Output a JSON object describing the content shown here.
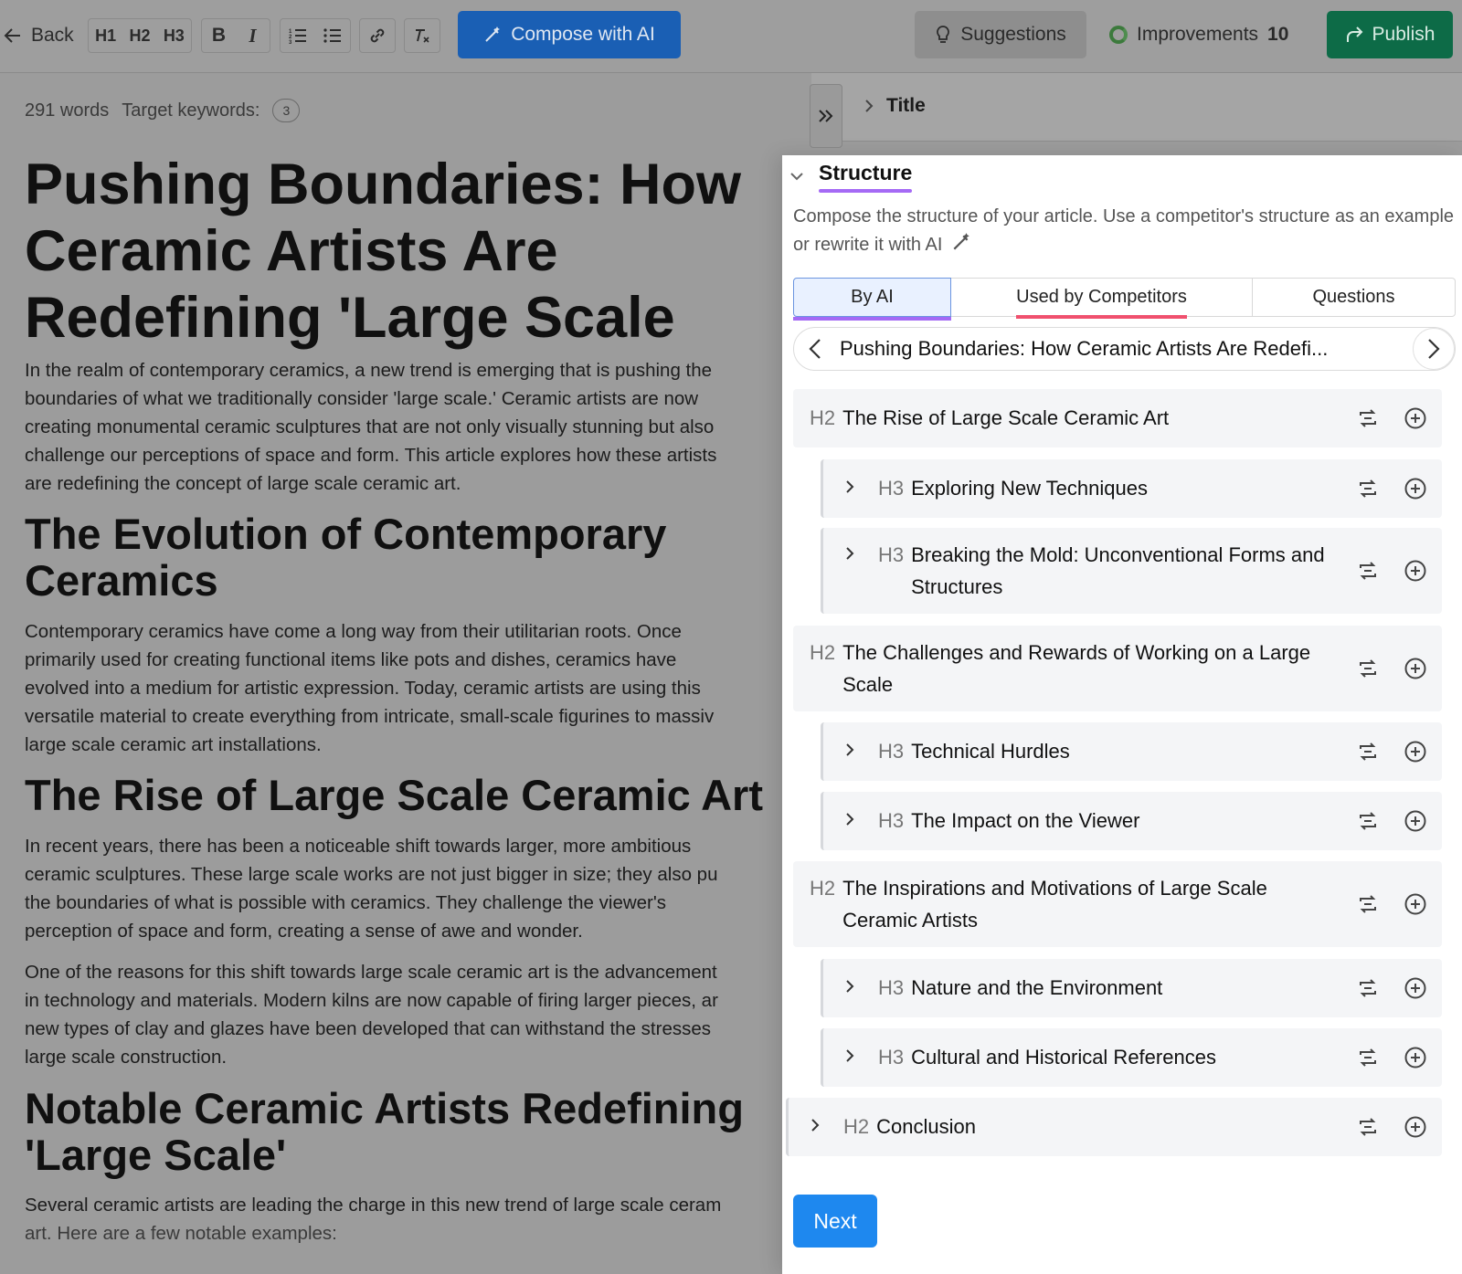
{
  "toolbar": {
    "back_label": "Back",
    "heading_buttons": [
      "H1",
      "H2",
      "H3"
    ],
    "bold_label": "B",
    "italic_label": "I",
    "compose_label": "Compose with AI",
    "suggestions_label": "Suggestions",
    "improvements_label": "Improvements",
    "improvements_count": "10",
    "publish_label": "Publish"
  },
  "editor": {
    "word_count": "291 words",
    "keywords_label": "Target keywords:",
    "keywords_count": "3",
    "title": "Pushing Boundaries: How Ceramic Artists Are Redefining 'Large Scale",
    "intro_lines": [
      "In the realm of contemporary ceramics, a new trend is emerging that is pushing the",
      "boundaries of what we traditionally consider 'large scale.' Ceramic artists are now",
      "creating monumental ceramic sculptures that are not only visually stunning but also",
      "challenge our perceptions of space and form. This article explores how these artists",
      "are redefining the concept of large scale ceramic art."
    ],
    "section1_heading": "The Evolution of Contemporary Ceramics",
    "section1_lines": [
      "Contemporary ceramics have come a long way from their utilitarian roots. Once",
      "primarily used for creating functional items like pots and dishes, ceramics have",
      "evolved into a medium for artistic expression. Today, ceramic artists are using this",
      "versatile material to create everything from intricate, small-scale figurines to massiv",
      "large scale ceramic art installations."
    ],
    "section2_heading": "The Rise of Large Scale Ceramic Art",
    "section2_lines": [
      "In recent years, there has been a noticeable shift towards larger, more ambitious",
      "ceramic sculptures. These large scale works are not just bigger in size; they also pu",
      "the boundaries of what is possible with ceramics. They challenge the viewer's",
      "perception of space and form, creating a sense of awe and wonder."
    ],
    "section2b_lines": [
      "One of the reasons for this shift towards large scale ceramic art is the advancement",
      "in technology and materials. Modern kilns are now capable of firing larger pieces, ar",
      "new types of clay and glazes have been developed that can withstand the stresses",
      "large scale construction."
    ],
    "section3_heading": "Notable Ceramic Artists Redefining 'Large Scale'",
    "section3_lines": [
      "Several ceramic artists are leading the charge in this new trend of large scale ceram",
      "art. Here are a few notable examples:"
    ]
  },
  "panel": {
    "title_section": "Title",
    "structure_title": "Structure",
    "structure_desc": "Compose the structure of your article. Use a competitor's structure as an example or rewrite it with AI",
    "tabs": [
      "By AI",
      "Used by Competitors",
      "Questions"
    ],
    "selected_title": "Pushing Boundaries: How Ceramic Artists Are Redefi...",
    "outline": [
      {
        "level": "H2",
        "text": "The Rise of Large Scale Ceramic Art"
      },
      {
        "level": "H3",
        "text": "Exploring New Techniques"
      },
      {
        "level": "H3",
        "text": "Breaking the Mold: Unconventional Forms and Structures"
      },
      {
        "level": "H2",
        "text": "The Challenges and Rewards of Working on a Large Scale"
      },
      {
        "level": "H3",
        "text": "Technical Hurdles"
      },
      {
        "level": "H3",
        "text": "The Impact on the Viewer"
      },
      {
        "level": "H2",
        "text": "The Inspirations and Motivations of Large Scale Ceramic Artists"
      },
      {
        "level": "H3",
        "text": "Nature and the Environment"
      },
      {
        "level": "H3",
        "text": "Cultural and Historical References"
      },
      {
        "level": "H2",
        "text": "Conclusion"
      }
    ],
    "next_label": "Next"
  },
  "colors": {
    "compose": "#1a5fb4",
    "publish": "#0d6b47",
    "accent_purple": "#a56af5",
    "accent_pink": "#f0506e",
    "next": "#1e88ef"
  }
}
